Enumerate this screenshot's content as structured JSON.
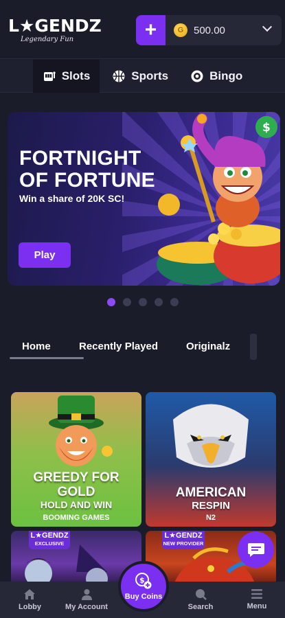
{
  "header": {
    "logo_text": "L★GENDZ",
    "logo_tagline": "Legendary Fun",
    "add_label": "+",
    "coin_symbol": "G",
    "balance": "500.00"
  },
  "categories": [
    {
      "label": "Slots",
      "icon": "slot-machine-icon",
      "active": true
    },
    {
      "label": "Sports",
      "icon": "basketball-icon",
      "active": false
    },
    {
      "label": "Bingo",
      "icon": "bingo-ball-icon",
      "active": false
    }
  ],
  "banner": {
    "title_line1": "FORTNIGHT",
    "title_line2": "OF FORTUNE",
    "subtitle": "Win a share of 20K SC!",
    "cta": "Play",
    "slide_count": 5,
    "active_slide": 0
  },
  "tabs": [
    {
      "label": "Home",
      "active": true
    },
    {
      "label": "Recently Played",
      "active": false
    },
    {
      "label": "Originalz",
      "active": false
    }
  ],
  "games": [
    {
      "title1": "GREEDY FOR",
      "title2": "GOLD",
      "title3": "HOLD AND WIN",
      "provider": "BOOMING GAMES"
    },
    {
      "title1": "AMERICAN",
      "title2": "RESPIN",
      "provider": "N2"
    },
    {
      "badge_logo": "L★GENDZ",
      "badge_text": "EXCLUSIVE"
    },
    {
      "badge_logo": "L★GENDZ",
      "badge_text": "NEW PROVIDER"
    }
  ],
  "bottom_nav": {
    "lobby": "Lobby",
    "account": "My Account",
    "buy": "Buy Coins",
    "search": "Search",
    "menu": "Menu"
  },
  "colors": {
    "background": "#1b1c2a",
    "accent": "#7b2ff0",
    "panel": "#262838"
  }
}
